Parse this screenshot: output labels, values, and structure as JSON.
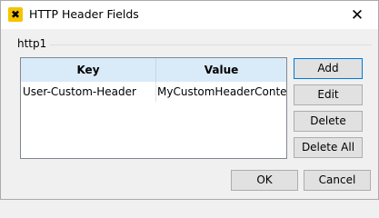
{
  "window": {
    "title": "HTTP Header Fields",
    "app_icon_glyph": "✖",
    "close_glyph": "✕"
  },
  "group": {
    "label": "http1"
  },
  "table": {
    "columns": [
      "Key",
      "Value"
    ],
    "rows": [
      {
        "key": "User-Custom-Header",
        "value": "MyCustomHeaderContent"
      }
    ],
    "header_color": "#d9ebf9"
  },
  "side_buttons": {
    "add": "Add",
    "edit": "Edit",
    "delete": "Delete",
    "delete_all": "Delete All"
  },
  "dialog_buttons": {
    "ok": "OK",
    "cancel": "Cancel"
  },
  "colors": {
    "accent": "#0078d7",
    "app_icon": "#f5c400"
  }
}
